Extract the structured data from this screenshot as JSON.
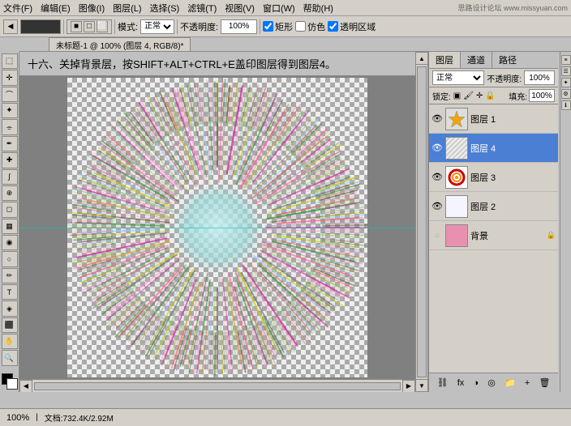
{
  "menubar": {
    "items": [
      "文件(F)",
      "编辑(E)",
      "图像(I)",
      "图层(L)",
      "选择(S)",
      "滤镜(T)",
      "视图(V)",
      "窗口(W)",
      "帮助(H)"
    ]
  },
  "toolbar": {
    "mode_label": "模式:",
    "mode_value": "正常",
    "opacity_label": "不透明度:",
    "opacity_value": "100%",
    "checkboxes": [
      "矩形",
      "仿色",
      "透明区域"
    ]
  },
  "tab": {
    "label": "未标题-1 @ 100% (图层 4, RGB/8)*"
  },
  "instruction": "十六、关掉背景层，按SHIFT+ALT+CTRL+E盖印图层得到图层4。",
  "layers": {
    "blend_mode": "正常",
    "opacity_label": "不透明度:",
    "opacity_value": "100%",
    "lock_label": "锁定:",
    "fill_label": "填充:",
    "fill_value": "100%",
    "items": [
      {
        "id": "layer1",
        "name": "图层 1",
        "visible": true,
        "selected": false,
        "thumb_type": "star",
        "locked": false
      },
      {
        "id": "layer4",
        "name": "图层 4",
        "visible": true,
        "selected": true,
        "thumb_type": "plain",
        "locked": false
      },
      {
        "id": "layer3",
        "name": "图层 3",
        "visible": true,
        "selected": false,
        "thumb_type": "ring",
        "locked": false
      },
      {
        "id": "layer2",
        "name": "图层 2",
        "visible": true,
        "selected": false,
        "thumb_type": "plain_light",
        "locked": false
      },
      {
        "id": "background",
        "name": "背景",
        "visible": false,
        "selected": false,
        "thumb_type": "pink",
        "locked": true
      }
    ],
    "panel_tabs": [
      "图层",
      "通道",
      "路径"
    ]
  },
  "statusbar": {
    "zoom": "100%",
    "doc_size": "文档:732.4K/2.92M"
  },
  "logo": "思路设计论坛 www.missyuan.com",
  "colors": {
    "selected_layer_bg": "#4a7fd4",
    "canvas_bg": "#808080"
  }
}
